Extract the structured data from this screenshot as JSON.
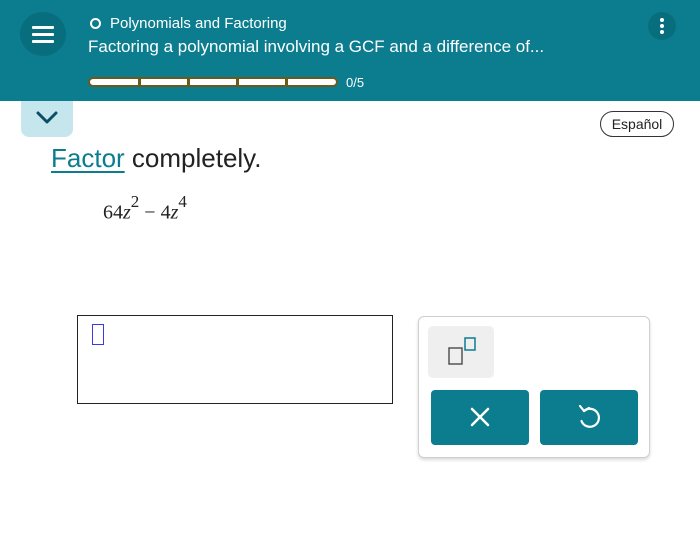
{
  "header": {
    "topic_title": "Polynomials and Factoring",
    "lesson_title": "Factoring a polynomial involving a GCF and a difference of...",
    "progress_text": "0/5",
    "progress": {
      "completed": 0,
      "total": 5
    }
  },
  "language_button": "Español",
  "problem": {
    "instruction_link": "Factor",
    "instruction_rest": " completely.",
    "expression": {
      "coef1": "64",
      "var1": "z",
      "exp1": "2",
      "operator": " − ",
      "coef2": "4",
      "var2": "z",
      "exp2": "4"
    }
  },
  "colors": {
    "header_bg": "#0b7d8f",
    "accent": "#0b7d8f",
    "progress_border": "#6b5a1c",
    "collapse_tab": "#c6e6ee",
    "cursor": "#3a3ae0"
  },
  "icons": {
    "menu": "hamburger-menu-icon",
    "more": "vertical-dots-icon",
    "collapse": "chevron-down-icon",
    "exponent": "superscript-box-icon",
    "clear": "x-icon",
    "undo": "undo-icon"
  }
}
